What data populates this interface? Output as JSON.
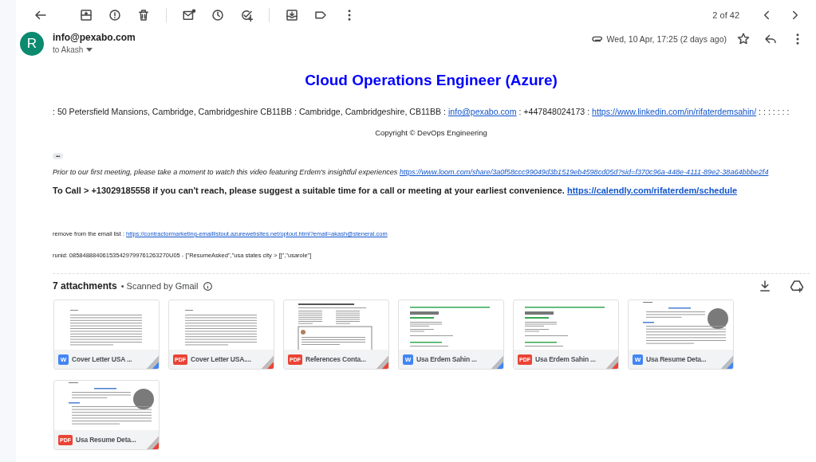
{
  "toolbar": {
    "pager": "2 of 42"
  },
  "message": {
    "avatar_letter": "R",
    "sender": "info@pexabo.com",
    "recipient": "to Akash",
    "date": "Wed, 10 Apr, 17:25 (2 days ago)",
    "has_attachment": true
  },
  "body": {
    "title": "Cloud Operations Engineer (Azure)",
    "paragraphs": [
      {
        "kind": "plain",
        "segments": [
          {
            "kind": "text",
            "text": ": 50 Petersfield Mansions, Cambridge, Cambridgeshire CB11BB : Cambridge, Cambridgeshire, CB11BB : "
          },
          {
            "kind": "link",
            "text": "info@pexabo.com"
          },
          {
            "kind": "text",
            "text": " : +447848024173 : "
          },
          {
            "kind": "link",
            "text": "https://www.linkedin.com/in/rifaterdemsahin/"
          },
          {
            "kind": "text",
            "text": " : : : : : : :"
          }
        ]
      },
      {
        "kind": "center",
        "segments": [
          {
            "kind": "text",
            "text": "Copyright © DevOps Engineering"
          }
        ]
      },
      {
        "kind": "more",
        "text": "•••"
      },
      {
        "kind": "italic",
        "segments": [
          {
            "kind": "text",
            "text": "Prior to our first meeting, please take a moment to watch this video featuring Erdem's insightful experiences "
          },
          {
            "kind": "link",
            "text": "https://www.loom.com/share/3a0f58ccc99049d3b1519eb4598cd05d?sid=f370c96a-448e-4111-89e2-38a64bbbe2f4"
          }
        ]
      },
      {
        "kind": "bold",
        "segments": [
          {
            "kind": "text",
            "text": "To Call > +13029185558 if you can't reach, please suggest a suitable time for a call or meeting at your earliest convenience. "
          },
          {
            "kind": "link",
            "text": "https://calendly.com/rifaterdem/schedule"
          }
        ]
      },
      {
        "kind": "small",
        "segments": [
          {
            "kind": "text",
            "text": "remove from the email list : "
          },
          {
            "kind": "link",
            "text": "https://contractormarketing-emaillistout.azurewebsites.net/optout.html?email=akash@steneral.com"
          }
        ]
      },
      {
        "kind": "small",
        "segments": [
          {
            "kind": "text",
            "text": "runid: 085848884061535429799761263270U05 - [\"ResumeAsked\",\"usa states city > []\",\"usarole\"]"
          }
        ]
      }
    ]
  },
  "attachments": {
    "count": "7 attachments",
    "scanned": "• Scanned by Gmail",
    "items": [
      {
        "name": "Cover Letter USA ...",
        "kind": "word",
        "badge": "W"
      },
      {
        "name": "Cover Letter USA....",
        "kind": "pdf",
        "badge": "PDF"
      },
      {
        "name": "References Conta...",
        "kind": "pdf",
        "badge": "PDF"
      },
      {
        "name": "Usa Erdem Sahin ...",
        "kind": "word",
        "badge": "W"
      },
      {
        "name": "Usa Erdem Sahin ...",
        "kind": "pdf",
        "badge": "PDF"
      },
      {
        "name": "Usa Resume Deta...",
        "kind": "word",
        "badge": "W"
      },
      {
        "name": "Usa Resume Deta...",
        "kind": "pdf",
        "badge": "PDF"
      }
    ]
  }
}
